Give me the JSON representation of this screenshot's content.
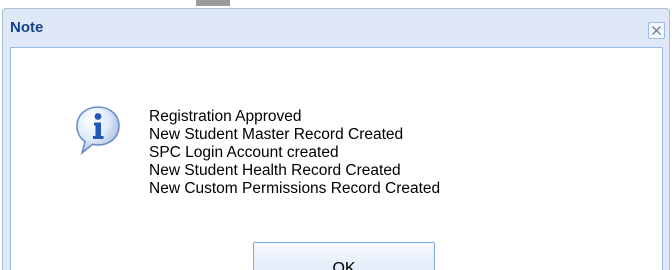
{
  "dialog": {
    "title": "Note",
    "icon": "info-icon",
    "messages": [
      "Registration Approved",
      "New Student Master Record Created",
      "SPC Login Account created",
      "New Student Health Record Created",
      "New Custom Permissions Record Created"
    ],
    "ok_label": "OK"
  },
  "colors": {
    "title_text": "#15428b",
    "frame": "#dfe8f6",
    "border": "#99bbe8"
  }
}
